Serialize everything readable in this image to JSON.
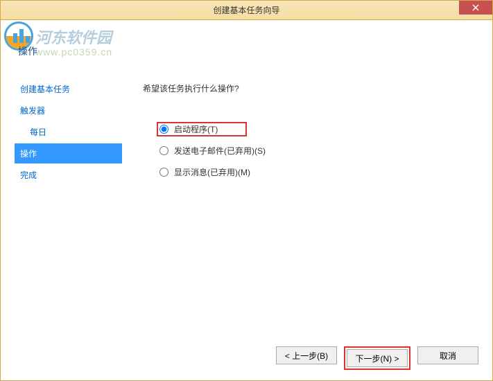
{
  "titlebar": {
    "title": "创建基本任务向导"
  },
  "header": {
    "section": "操作"
  },
  "watermark": {
    "text": "河东软件园",
    "url": "www.pc0359.cn"
  },
  "sidebar": {
    "items": [
      {
        "label": "创建基本任务",
        "indent": false,
        "active": false
      },
      {
        "label": "触发器",
        "indent": false,
        "active": false
      },
      {
        "label": "每日",
        "indent": true,
        "active": false
      },
      {
        "label": "操作",
        "indent": false,
        "active": true
      },
      {
        "label": "完成",
        "indent": false,
        "active": false
      }
    ]
  },
  "main": {
    "question": "希望该任务执行什么操作?",
    "options": [
      {
        "label": "启动程序(T)",
        "checked": true,
        "highlighted": true
      },
      {
        "label": "发送电子邮件(已弃用)(S)",
        "checked": false,
        "highlighted": false
      },
      {
        "label": "显示消息(已弃用)(M)",
        "checked": false,
        "highlighted": false
      }
    ]
  },
  "footer": {
    "back": "< 上一步(B)",
    "next": "下一步(N) >",
    "cancel": "取消"
  }
}
